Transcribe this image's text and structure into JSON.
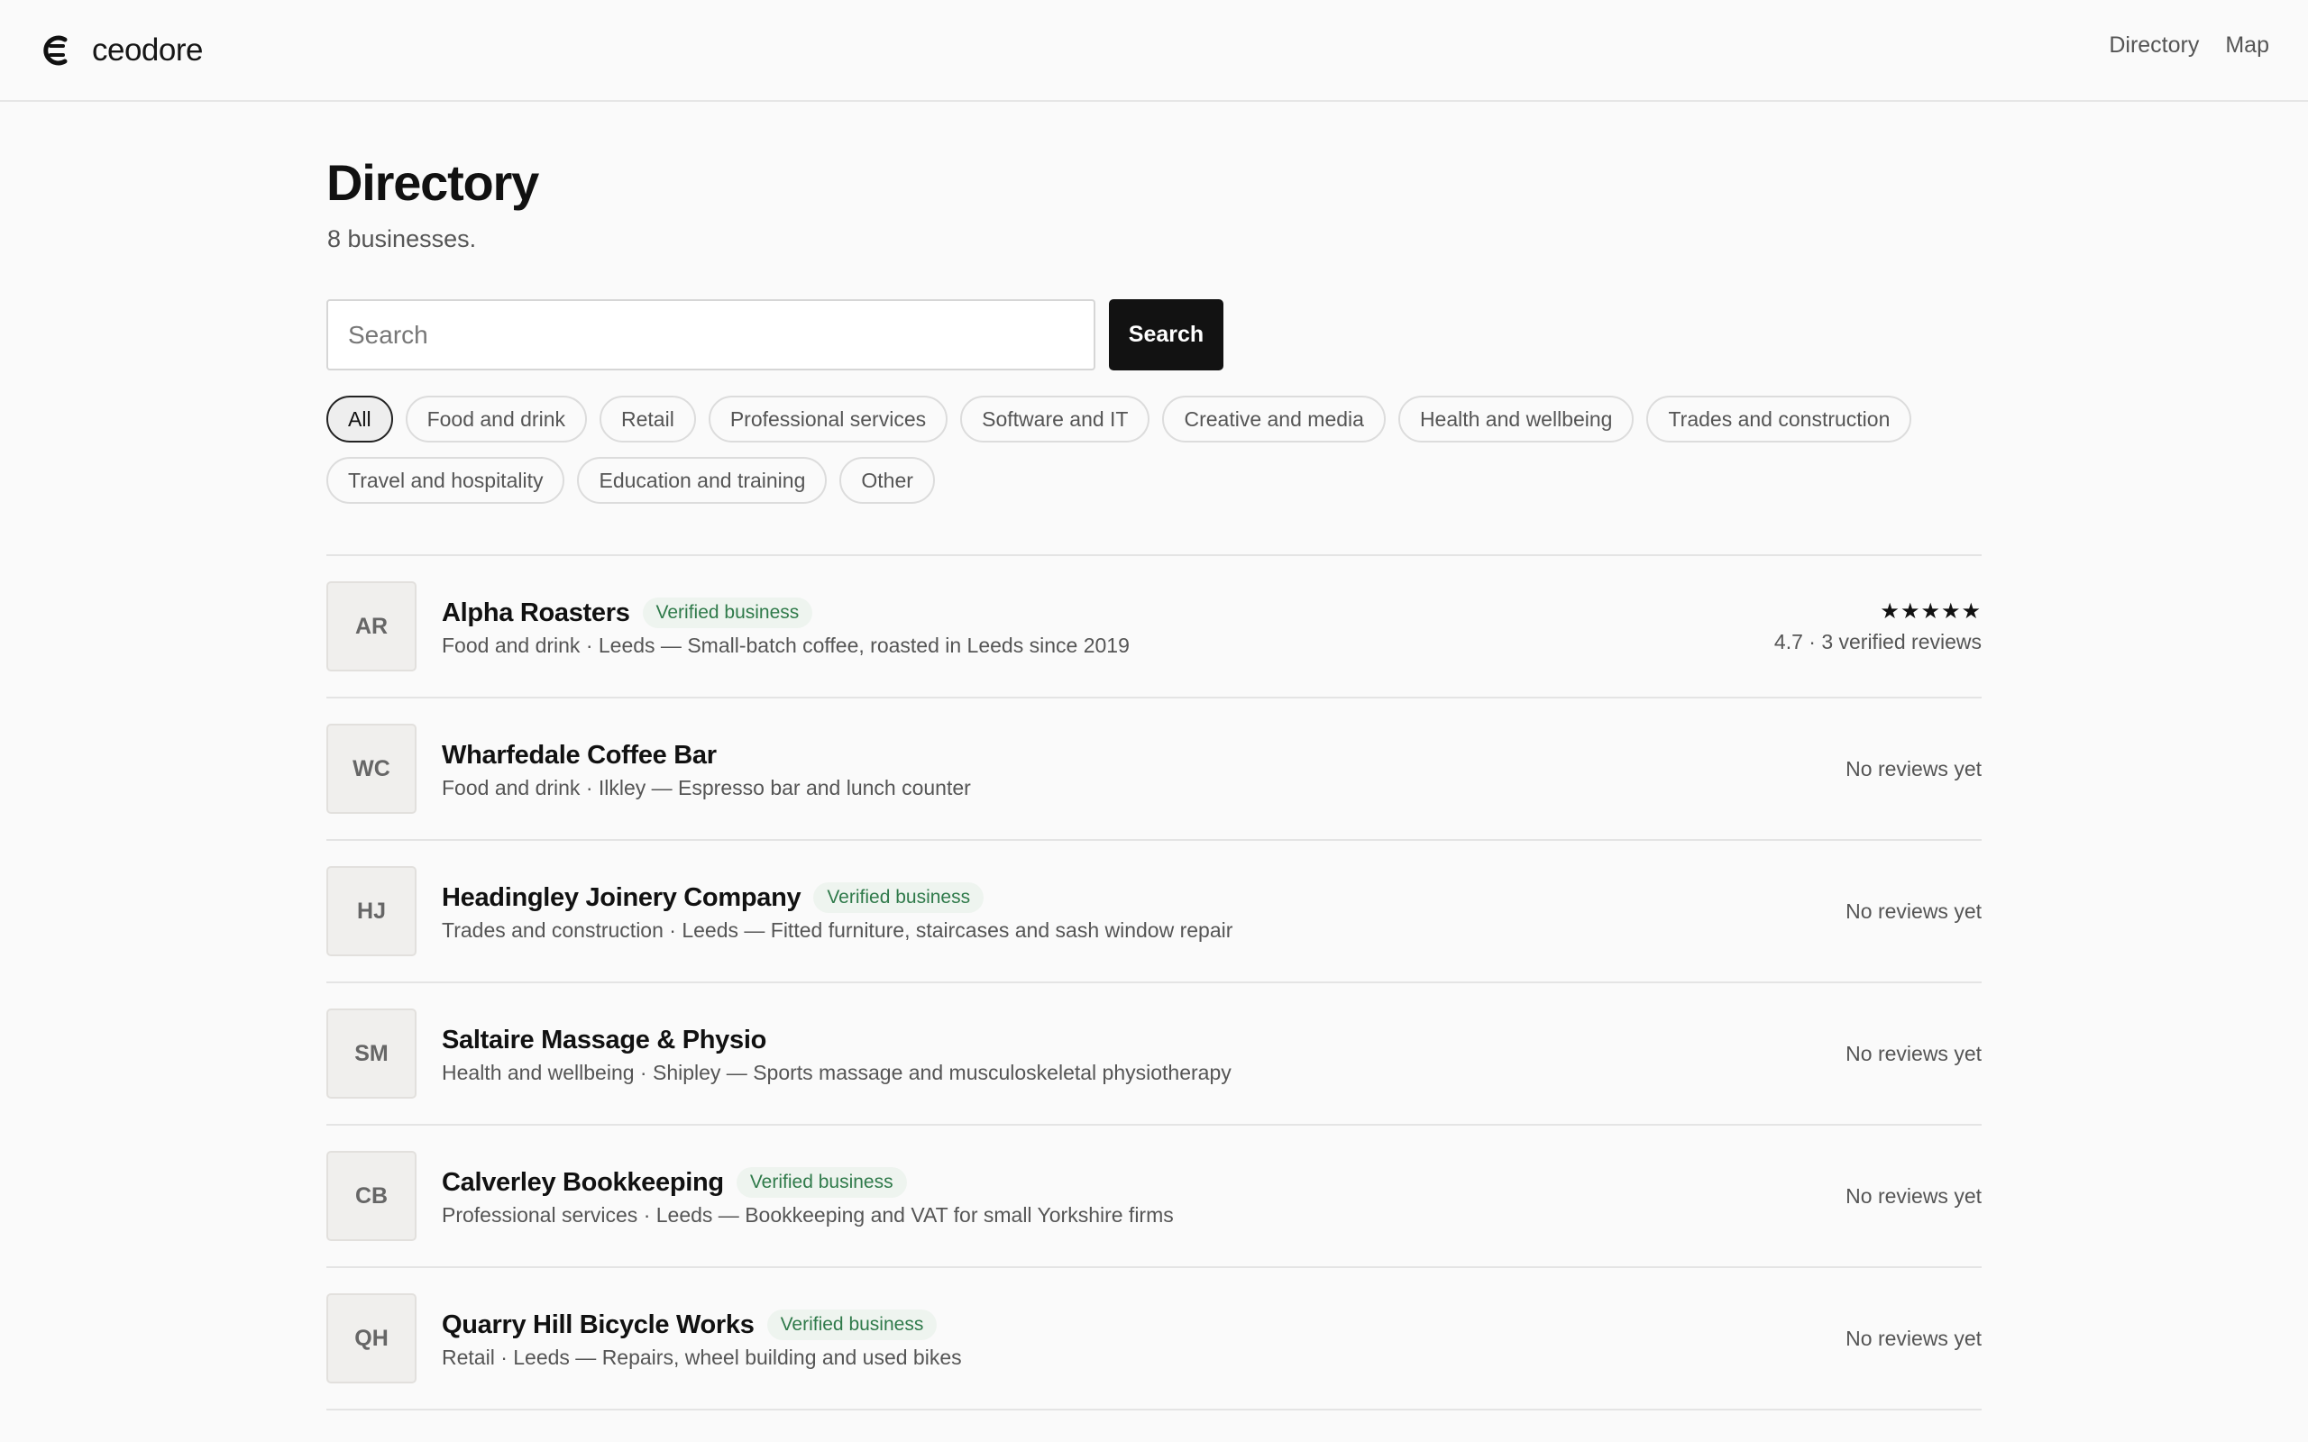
{
  "header": {
    "brand_name": "ceodore",
    "nav": [
      {
        "label": "Directory"
      },
      {
        "label": "Map"
      }
    ]
  },
  "page": {
    "title": "Directory",
    "count": "8 businesses."
  },
  "search": {
    "placeholder": "Search",
    "value": "",
    "button_label": "Search"
  },
  "filters": [
    {
      "label": "All",
      "active": true
    },
    {
      "label": "Food and drink",
      "active": false
    },
    {
      "label": "Retail",
      "active": false
    },
    {
      "label": "Professional services",
      "active": false
    },
    {
      "label": "Software and IT",
      "active": false
    },
    {
      "label": "Creative and media",
      "active": false
    },
    {
      "label": "Health and wellbeing",
      "active": false
    },
    {
      "label": "Trades and construction",
      "active": false
    },
    {
      "label": "Travel and hospitality",
      "active": false
    },
    {
      "label": "Education and training",
      "active": false
    },
    {
      "label": "Other",
      "active": false
    }
  ],
  "businesses": [
    {
      "initials": "AR",
      "name": "Alpha Roasters",
      "verified": true,
      "badge": "Verified business",
      "subtitle": "Food and drink · Leeds — Small-batch coffee, roasted in Leeds since 2019",
      "stars": "★★★★★",
      "rating": 4.7,
      "reviews_text": "4.7 · 3 verified reviews"
    },
    {
      "initials": "WC",
      "name": "Wharfedale Coffee Bar",
      "verified": false,
      "badge": "",
      "subtitle": "Food and drink · Ilkley — Espresso bar and lunch counter",
      "stars": "",
      "reviews_text": "No reviews yet"
    },
    {
      "initials": "HJ",
      "name": "Headingley Joinery Company",
      "verified": true,
      "badge": "Verified business",
      "subtitle": "Trades and construction · Leeds — Fitted furniture, staircases and sash window repair",
      "stars": "",
      "reviews_text": "No reviews yet"
    },
    {
      "initials": "SM",
      "name": "Saltaire Massage & Physio",
      "verified": false,
      "badge": "",
      "subtitle": "Health and wellbeing · Shipley — Sports massage and musculoskeletal physiotherapy",
      "stars": "",
      "reviews_text": "No reviews yet"
    },
    {
      "initials": "CB",
      "name": "Calverley Bookkeeping",
      "verified": true,
      "badge": "Verified business",
      "subtitle": "Professional services · Leeds — Bookkeeping and VAT for small Yorkshire firms",
      "stars": "",
      "reviews_text": "No reviews yet"
    },
    {
      "initials": "QH",
      "name": "Quarry Hill Bicycle Works",
      "verified": true,
      "badge": "Verified business",
      "subtitle": "Retail · Leeds — Repairs, wheel building and used bikes",
      "stars": "",
      "reviews_text": "No reviews yet"
    }
  ]
}
